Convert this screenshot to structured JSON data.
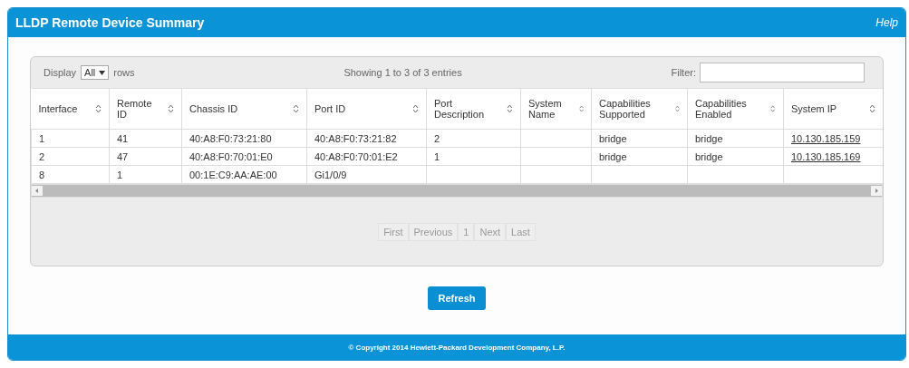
{
  "panel": {
    "title": "LLDP Remote Device Summary",
    "help": "Help"
  },
  "table_controls": {
    "display_label": "Display",
    "display_value": "All",
    "rows_label": "rows",
    "info": "Showing 1 to 3 of 3 entries",
    "filter_label": "Filter:"
  },
  "table": {
    "columns": [
      "Interface",
      "Remote ID",
      "Chassis ID",
      "Port ID",
      "Port Description",
      "System Name",
      "Capabilities Supported",
      "Capabilities Enabled",
      "System IP"
    ],
    "rows": [
      [
        "1",
        "41",
        "40:A8:F0:73:21:80",
        "40:A8:F0:73:21:82",
        "2",
        "",
        "bridge",
        "bridge",
        "10.130.185.159"
      ],
      [
        "2",
        "47",
        "40:A8:F0:70:01:E0",
        "40:A8:F0:70:01:E2",
        "1",
        "",
        "bridge",
        "bridge",
        "10.130.185.169"
      ],
      [
        "8",
        "1",
        "00:1E:C9:AA:AE:00",
        "Gi1/0/9",
        "",
        "",
        "",
        "",
        ""
      ]
    ]
  },
  "pager": [
    "First",
    "Previous",
    "1",
    "Next",
    "Last"
  ],
  "refresh_button": "Refresh",
  "footer": "© Copyright 2014 Hewlett-Packard Development Company, L.P."
}
